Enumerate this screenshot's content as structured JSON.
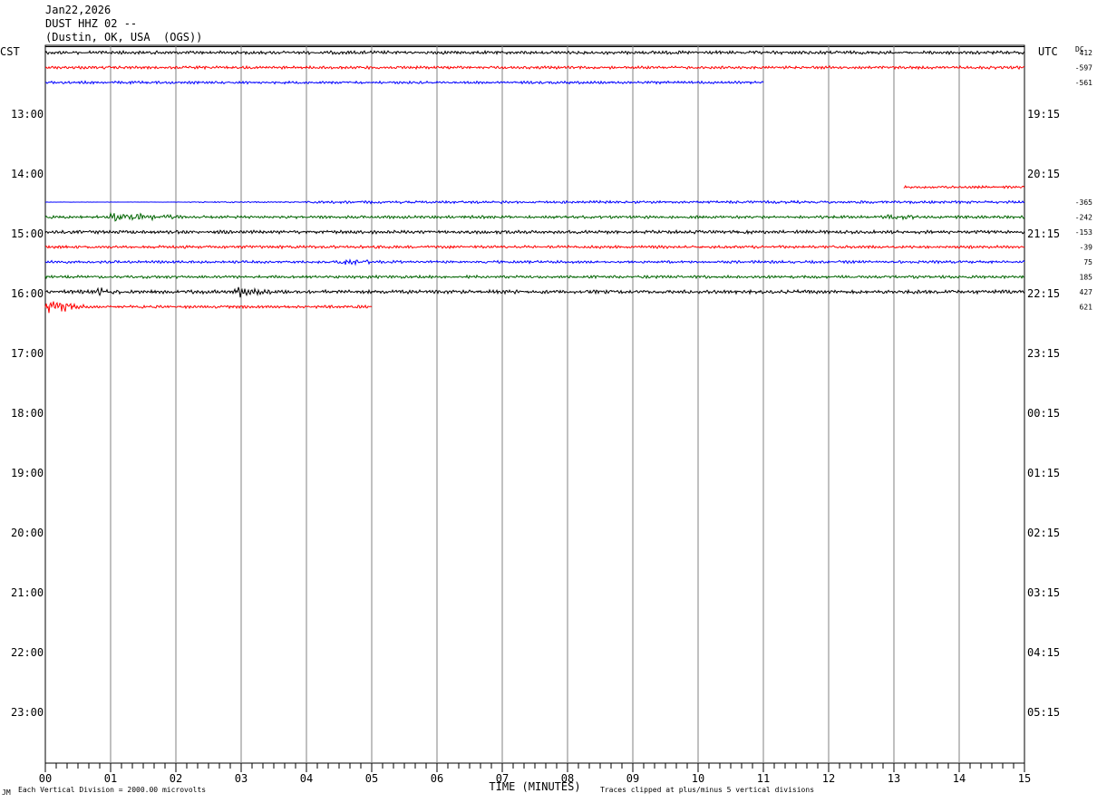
{
  "header": {
    "date": "Jan22,2026",
    "station": "DUST HHZ 02 --",
    "location": "(Dustin, OK, USA  (OGS))"
  },
  "labels": {
    "left_tz": "CST",
    "right_tz": "UTC",
    "dc": "DC",
    "xlabel": "TIME (MINUTES)",
    "scale_note": "Each Vertical Division = 2000.00 microvolts",
    "clip_note": "Traces clipped at plus/minus 5 vertical divisions",
    "corner_mark": "JM"
  },
  "chart_data": {
    "type": "line",
    "x_ticks": [
      "00",
      "01",
      "02",
      "03",
      "04",
      "05",
      "06",
      "07",
      "08",
      "09",
      "10",
      "11",
      "12",
      "13",
      "14",
      "15"
    ],
    "xlim": [
      0,
      15
    ],
    "left_hour_labels": [
      "13:00",
      "14:00",
      "15:00",
      "16:00",
      "17:00",
      "18:00",
      "19:00",
      "20:00",
      "21:00",
      "22:00",
      "23:00"
    ],
    "right_hour_labels": [
      "19:15",
      "20:15",
      "21:15",
      "22:15",
      "23:15",
      "00:15",
      "01:15",
      "02:15",
      "03:15",
      "04:15",
      "05:15"
    ],
    "colors": {
      "black": "#000000",
      "red": "#ff0000",
      "blue": "#0000ff",
      "green": "#006400",
      "grid": "#808080"
    },
    "traces": [
      {
        "row": 0,
        "color": "black",
        "start": 0,
        "end": 15,
        "dc": "412",
        "noise": 1.6
      },
      {
        "row": 1,
        "color": "red",
        "start": 0,
        "end": 15,
        "dc": "-597",
        "noise": 1.4
      },
      {
        "row": 2,
        "color": "blue",
        "start": 0,
        "end": 11,
        "dc": "-561",
        "noise": 1.3
      },
      {
        "row": 9,
        "color": "red",
        "start": 13.15,
        "end": 15,
        "dc": "",
        "noise": 1.2
      },
      {
        "row": 10,
        "color": "blue",
        "start": 0,
        "end": 15,
        "dc": "-365",
        "noise": 1.3,
        "flat_until": 4.0
      },
      {
        "row": 11,
        "color": "green",
        "start": 0,
        "end": 15,
        "dc": "-242",
        "noise": 1.4,
        "events": [
          [
            1.0,
            2.2,
            4.5
          ],
          [
            12.9,
            13.6,
            3.0
          ]
        ]
      },
      {
        "row": 12,
        "color": "black",
        "start": 0,
        "end": 15,
        "dc": "-153",
        "noise": 1.6
      },
      {
        "row": 13,
        "color": "red",
        "start": 0,
        "end": 15,
        "dc": "-39",
        "noise": 1.4
      },
      {
        "row": 14,
        "color": "blue",
        "start": 0,
        "end": 15,
        "dc": "75",
        "noise": 1.3,
        "events": [
          [
            4.5,
            5.3,
            3.5
          ]
        ]
      },
      {
        "row": 15,
        "color": "green",
        "start": 0,
        "end": 15,
        "dc": "185",
        "noise": 1.4
      },
      {
        "row": 16,
        "color": "black",
        "start": 0,
        "end": 15,
        "dc": "427",
        "noise": 1.8,
        "events": [
          [
            0.8,
            1.2,
            6
          ],
          [
            2.9,
            3.5,
            6
          ],
          [
            14.8,
            15,
            4
          ]
        ]
      },
      {
        "row": 17,
        "color": "red",
        "start": 0,
        "end": 5.0,
        "dc": "621",
        "noise": 1.4,
        "events": [
          [
            0,
            0.6,
            7
          ]
        ]
      }
    ]
  }
}
